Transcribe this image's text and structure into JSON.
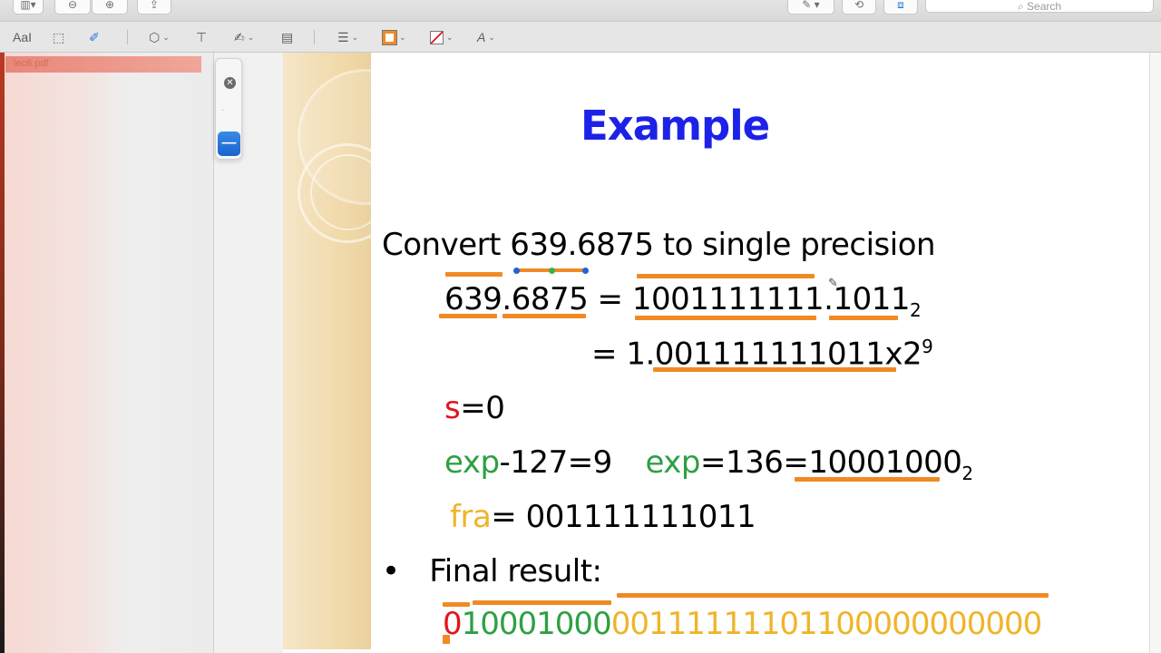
{
  "toolbar": {
    "search_placeholder": "Search",
    "text_style_label": "AaI"
  },
  "sidebar": {
    "file_name": "lec6.pdf"
  },
  "slide": {
    "title": "Example",
    "line1": "Convert 639.6875 to single precision",
    "line2_lhs": "639.6875",
    "line2_eq": "=",
    "line2_rhs": "1001111111.1011",
    "line2_sub": "2",
    "line3_eq": "=",
    "line3_val": "1.001111111011x2",
    "line3_sup": "9",
    "s_label": "s",
    "s_value": "=0",
    "exp_label1": "exp",
    "exp_value1": "-127=9",
    "exp_label2": "exp",
    "exp_value2": "=136=10001000",
    "exp_sub": "2",
    "fra_label": "fra",
    "fra_value": "= 001111111011",
    "bullet": "•",
    "final_label": "Final result:",
    "final_sign": "0",
    "final_exp": "10001000",
    "final_fra": "00111111101100000000000"
  },
  "colors": {
    "title": "#1c22e8",
    "sign": "#e3141d",
    "exponent": "#2ea043",
    "fraction": "#f0b429",
    "annotation": "#f08a24"
  }
}
